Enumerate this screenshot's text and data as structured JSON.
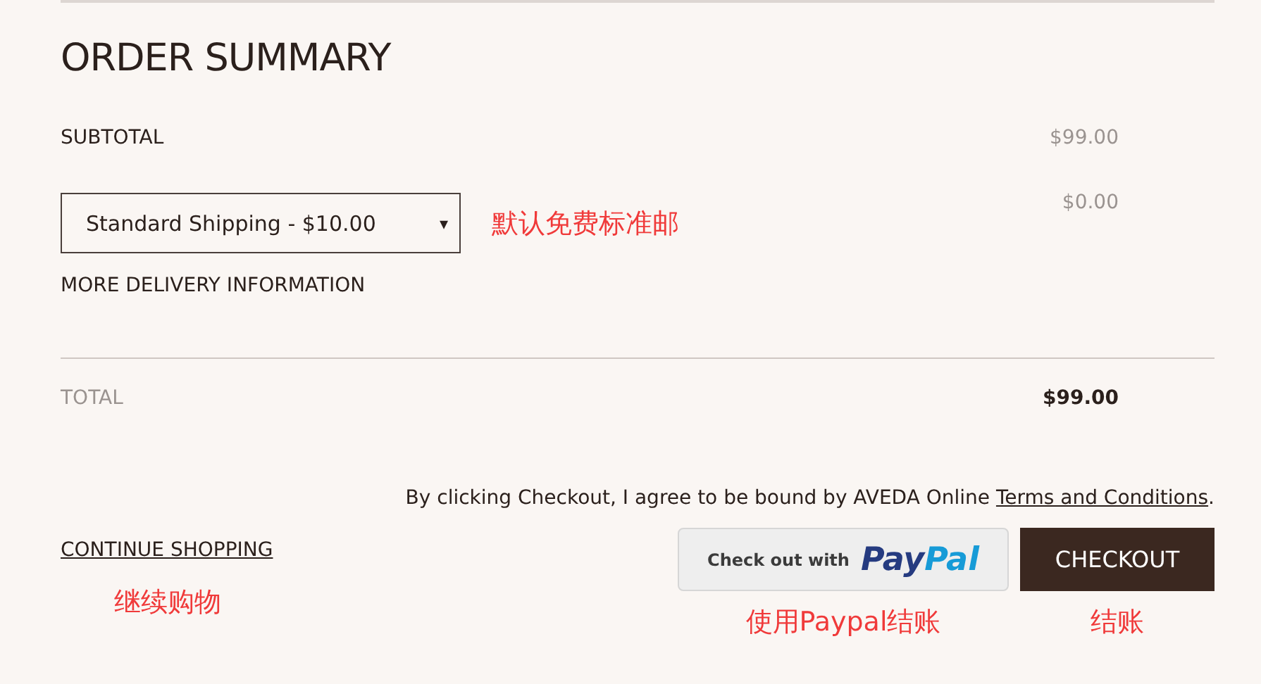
{
  "title": "ORDER SUMMARY",
  "subtotal": {
    "label": "SUBTOTAL",
    "value": "$99.00"
  },
  "shipping": {
    "selected_option": "Standard Shipping - $10.00",
    "arrow": "▾",
    "value": "$0.00",
    "link": "MORE DELIVERY INFORMATION"
  },
  "total": {
    "label": "TOTAL",
    "value": "$99.00"
  },
  "terms": {
    "text": "By clicking Checkout, I agree to be bound by AVEDA Online ",
    "link": "Terms and Conditions",
    "end": "."
  },
  "continue_link": "CONTINUE SHOPPING",
  "paypal_button": {
    "prefix": "Check out with",
    "logo": [
      "Pay",
      "Pal"
    ]
  },
  "checkout_button": "CHECKOUT",
  "annotations": [
    {
      "text": "默认免费标准邮"
    },
    {
      "text": "继续购物"
    },
    {
      "text": "使用Paypal结账"
    },
    {
      "text": "结账"
    }
  ]
}
